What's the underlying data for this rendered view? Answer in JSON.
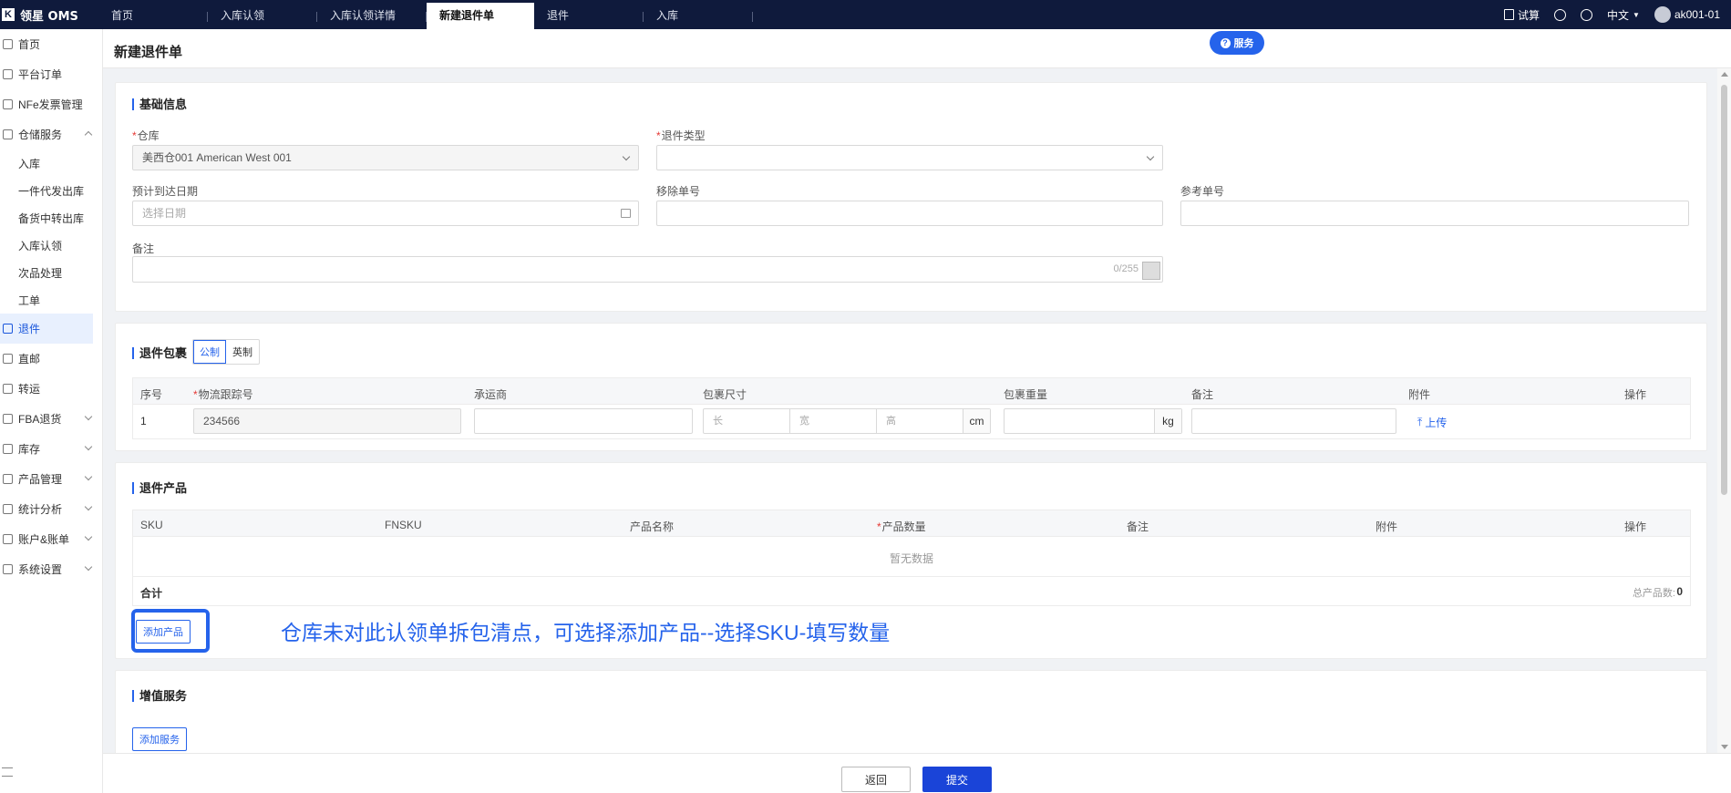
{
  "app": {
    "logo_mark": "K",
    "name": "领星 OMS"
  },
  "tabs": [
    {
      "label": "首页"
    },
    {
      "label": "入库认领"
    },
    {
      "label": "入库认领详情"
    },
    {
      "label": "新建退件单",
      "active": true
    },
    {
      "label": "退件"
    },
    {
      "label": "入库"
    }
  ],
  "topbar": {
    "trial": "试算",
    "language": "中文",
    "user": "ak001-01"
  },
  "sidebar": {
    "items": [
      {
        "label": "首页",
        "icon": "home-icon"
      },
      {
        "label": "平台订单",
        "icon": "order-icon"
      },
      {
        "label": "NFe发票管理",
        "icon": "invoice-icon"
      },
      {
        "label": "仓储服务",
        "icon": "warehouse-icon",
        "expanded": true
      },
      {
        "label": "入库",
        "sub": true
      },
      {
        "label": "一件代发出库",
        "sub": true
      },
      {
        "label": "备货中转出库",
        "sub": true
      },
      {
        "label": "入库认领",
        "sub": true
      },
      {
        "label": "次品处理",
        "sub": true
      },
      {
        "label": "工单",
        "sub": true
      },
      {
        "label": "退件",
        "icon": "return-icon",
        "active": true
      },
      {
        "label": "直邮",
        "icon": "mail-icon"
      },
      {
        "label": "转运",
        "icon": "transfer-icon"
      },
      {
        "label": "FBA退货",
        "icon": "fba-icon",
        "collapsed": true
      },
      {
        "label": "库存",
        "icon": "inventory-icon",
        "collapsed": true
      },
      {
        "label": "产品管理",
        "icon": "product-icon",
        "collapsed": true
      },
      {
        "label": "统计分析",
        "icon": "chart-icon",
        "collapsed": true
      },
      {
        "label": "账户&账单",
        "icon": "account-icon",
        "collapsed": true
      },
      {
        "label": "系统设置",
        "icon": "settings-icon",
        "collapsed": true
      }
    ]
  },
  "page": {
    "title": "新建退件单",
    "service_button": "服务"
  },
  "basic": {
    "section": "基础信息",
    "warehouse_label": "仓库",
    "warehouse_value": "美西仓001 American West 001",
    "return_type_label": "退件类型",
    "return_type_value": "",
    "eta_label": "预计到达日期",
    "eta_placeholder": "选择日期",
    "removal_label": "移除单号",
    "reference_label": "参考单号",
    "remark_label": "备注",
    "remark_counter": "0/255"
  },
  "package": {
    "section": "退件包裹",
    "unit_metric": "公制",
    "unit_imperial": "英制",
    "columns": [
      "序号",
      "物流跟踪号",
      "承运商",
      "包裹尺寸",
      "包裹重量",
      "备注",
      "附件",
      "操作"
    ],
    "row": {
      "index": "1",
      "tracking": "234566",
      "length_ph": "长",
      "width_ph": "宽",
      "height_ph": "高",
      "dim_unit": "cm",
      "weight_unit": "kg",
      "upload": "上传"
    }
  },
  "products": {
    "section": "退件产品",
    "columns": [
      "SKU",
      "FNSKU",
      "产品名称",
      "产品数量",
      "备注",
      "附件",
      "操作"
    ],
    "empty": "暂无数据",
    "total_label": "合计",
    "total_count_label": "总产品数:",
    "total_count": "0",
    "add_button": "添加产品",
    "annotation": "仓库未对此认领单拆包清点，可选择添加产品--选择SKU-填写数量"
  },
  "value_added": {
    "section": "增值服务",
    "add_button": "添加服务"
  },
  "footer": {
    "back": "返回",
    "submit": "提交"
  }
}
